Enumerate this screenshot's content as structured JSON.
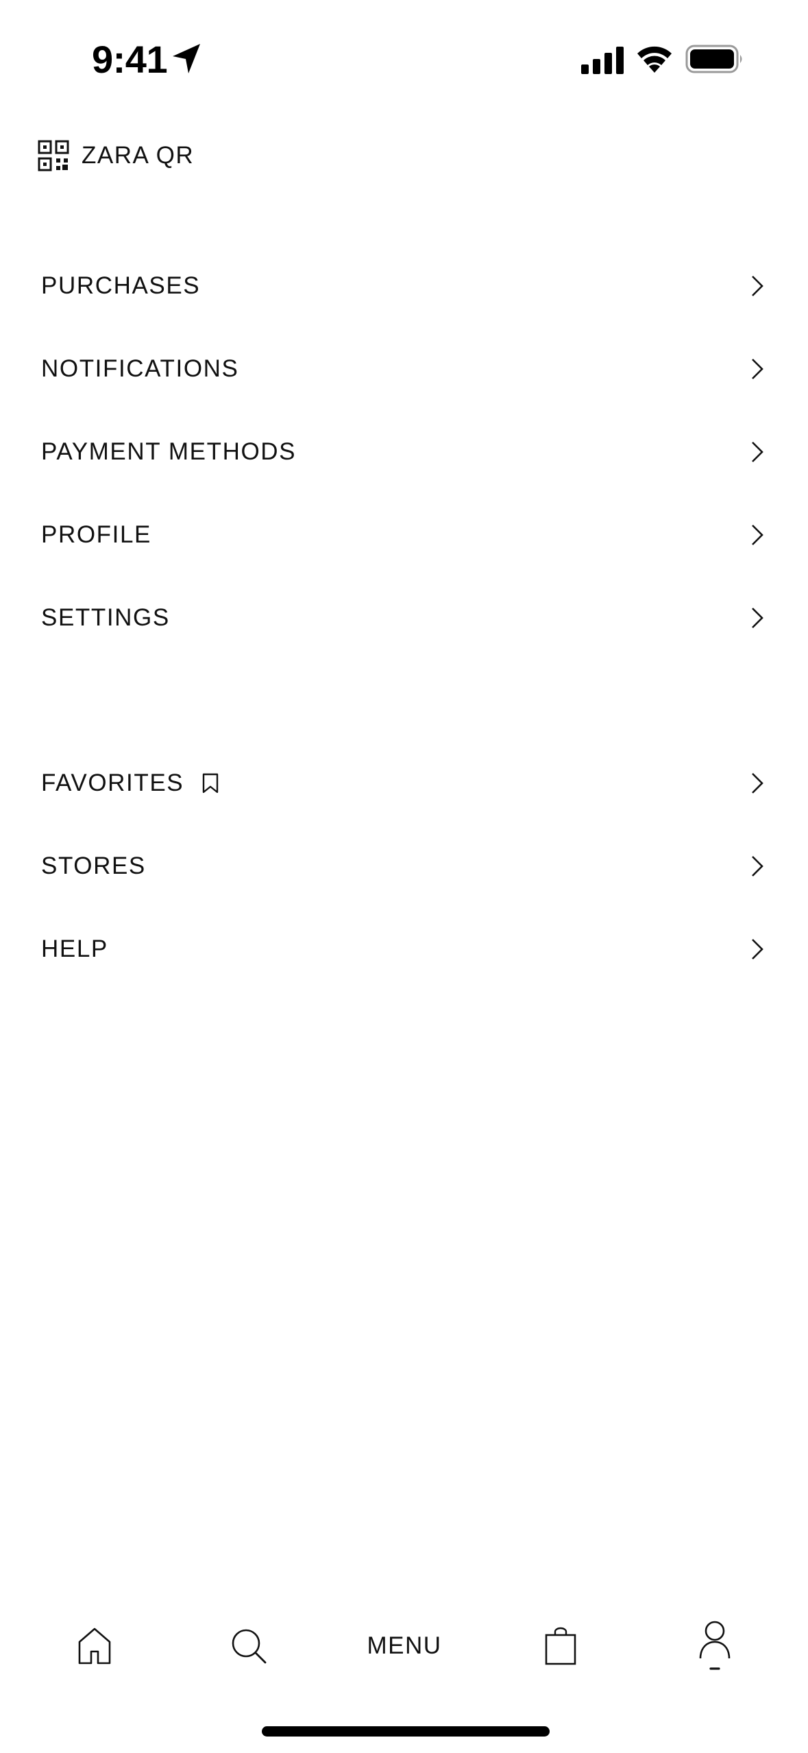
{
  "status_bar": {
    "time": "9:41"
  },
  "qr": {
    "label": "ZARA QR",
    "icon": "qr-code-icon"
  },
  "account_menu": [
    {
      "label": "PURCHASES"
    },
    {
      "label": "NOTIFICATIONS"
    },
    {
      "label": "PAYMENT METHODS"
    },
    {
      "label": "PROFILE"
    },
    {
      "label": "SETTINGS"
    }
  ],
  "secondary_menu": [
    {
      "label": "FAVORITES",
      "icon": "bookmark-icon"
    },
    {
      "label": "STORES"
    },
    {
      "label": "HELP"
    }
  ],
  "tab_bar": {
    "home_icon": "home-icon",
    "search_icon": "search-icon",
    "menu_label": "MENU",
    "bag_icon": "shopping-bag-icon",
    "account_icon": "account-icon",
    "active_tab": "account"
  },
  "colors": {
    "text": "#111111",
    "background": "#ffffff"
  }
}
